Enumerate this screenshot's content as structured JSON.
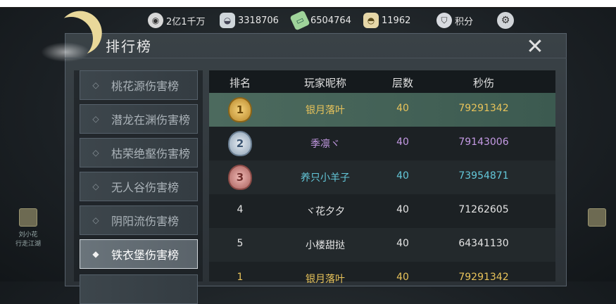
{
  "resources": [
    {
      "icon": "film-reel-icon",
      "value": "2亿1千万"
    },
    {
      "icon": "silver-bowl-icon",
      "value": "3318706"
    },
    {
      "icon": "jade-ticket-icon",
      "value": "6504764"
    },
    {
      "icon": "gold-ingot-icon",
      "value": "11962"
    },
    {
      "icon": "shield-points-icon",
      "value": "积分"
    }
  ],
  "panel": {
    "title": "排行榜"
  },
  "sidebar": {
    "items": [
      {
        "label": "桃花源伤害榜",
        "active": false
      },
      {
        "label": "潜龙在渊伤害榜",
        "active": false
      },
      {
        "label": "枯荣绝壑伤害榜",
        "active": false
      },
      {
        "label": "无人谷伤害榜",
        "active": false
      },
      {
        "label": "阴阳流伤害榜",
        "active": false
      },
      {
        "label": "铁衣堡伤害榜",
        "active": true
      }
    ]
  },
  "table": {
    "headers": [
      "排名",
      "玩家昵称",
      "层数",
      "秒伤"
    ],
    "rows": [
      {
        "rank": "1",
        "name": "银月落叶",
        "floor": "40",
        "dps": "79291342",
        "color": "gold"
      },
      {
        "rank": "2",
        "name": "季凛ヾ",
        "floor": "40",
        "dps": "79143006",
        "color": "purple"
      },
      {
        "rank": "3",
        "name": "养只小羊子",
        "floor": "40",
        "dps": "73954871",
        "color": "blue"
      },
      {
        "rank": "4",
        "name": "ヾ花夕夕",
        "floor": "40",
        "dps": "71262605",
        "color": "white"
      },
      {
        "rank": "5",
        "name": "小楼甜挞",
        "floor": "40",
        "dps": "64341130",
        "color": "white"
      },
      {
        "rank": "1",
        "name": "银月落叶",
        "floor": "40",
        "dps": "79291342",
        "color": "gold"
      }
    ]
  },
  "side_characters": {
    "left": {
      "name": "刘小花",
      "sub": "行走江湖"
    },
    "right": {
      "name": "",
      "sub": ""
    }
  },
  "colors": {
    "gold": "#e8c35a",
    "purple": "#c49ae4",
    "blue": "#63c7d9",
    "highlight_row": "#4c6a5e"
  }
}
